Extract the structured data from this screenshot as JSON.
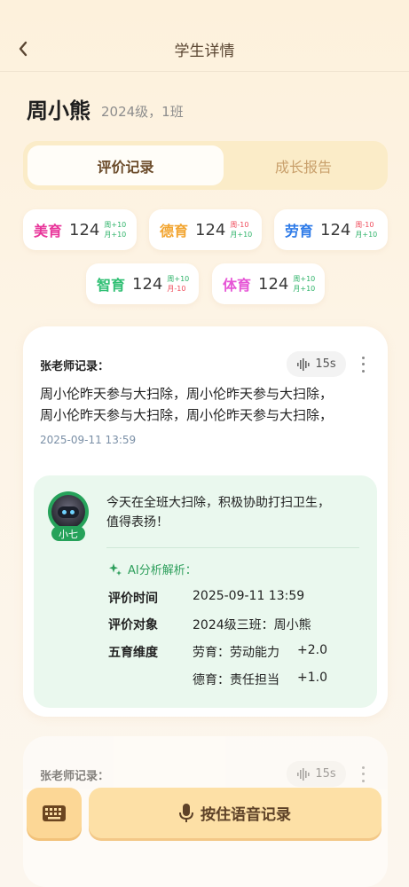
{
  "nav": {
    "title": "学生详情",
    "back_icon": "chevron-left-icon"
  },
  "student": {
    "name": "周小熊",
    "class": "2024级，1班"
  },
  "tabs": [
    {
      "label": "评价记录",
      "active": true
    },
    {
      "label": "成长报告",
      "active": false
    }
  ],
  "scores": [
    {
      "label": "美育",
      "value": "124",
      "week": "周+10",
      "month": "月+10",
      "color": "#e8359a",
      "week_color": "#2fb36a",
      "month_color": "#2fb36a"
    },
    {
      "label": "德育",
      "value": "124",
      "week": "周-10",
      "month": "月+10",
      "color": "#f2a531",
      "week_color": "#ef4b5b",
      "month_color": "#2fb36a"
    },
    {
      "label": "劳育",
      "value": "124",
      "week": "周-10",
      "month": "月+10",
      "color": "#2e7be8",
      "week_color": "#ef4b5b",
      "month_color": "#2fb36a"
    },
    {
      "label": "智育",
      "value": "124",
      "week": "周+10",
      "month": "月-10",
      "color": "#2fbf73",
      "week_color": "#2fb36a",
      "month_color": "#ef4b5b"
    },
    {
      "label": "体育",
      "value": "124",
      "week": "周+10",
      "month": "月+10",
      "color": "#e656d6",
      "week_color": "#2fb36a",
      "month_color": "#2fb36a"
    }
  ],
  "record": {
    "title": "张老师记录：",
    "audio_duration": "15s",
    "text_line1": "周小伦昨天参与大扫除，周小伦昨天参与大扫除，",
    "text_line2": "周小伦昨天参与大扫除，周小伦昨天参与大扫除，",
    "time": "2025-09-11 13:59",
    "ai": {
      "avatar_label": "小七",
      "summary_line1": "今天在全班大扫除，积极协助打扫卫生，",
      "summary_line2": "值得表扬！",
      "head": "AI分析解析：",
      "rows": {
        "time_key": "评价时间",
        "time_val": "2025-09-11 13:59",
        "target_key": "评价对象",
        "target_val": "2024级三班：周小熊",
        "dim_key": "五育维度",
        "dim1": "劳育：劳动能力",
        "dim1_score": "+2.0",
        "dim2": "德育：责任担当",
        "dim2_score": "+1.0"
      }
    }
  },
  "record2": {
    "title": "张老师记录：",
    "audio_duration": "15s"
  },
  "bottom": {
    "keyboard_icon": "keyboard-icon",
    "voice_label": "按住语音记录",
    "mic_icon": "microphone-icon"
  }
}
